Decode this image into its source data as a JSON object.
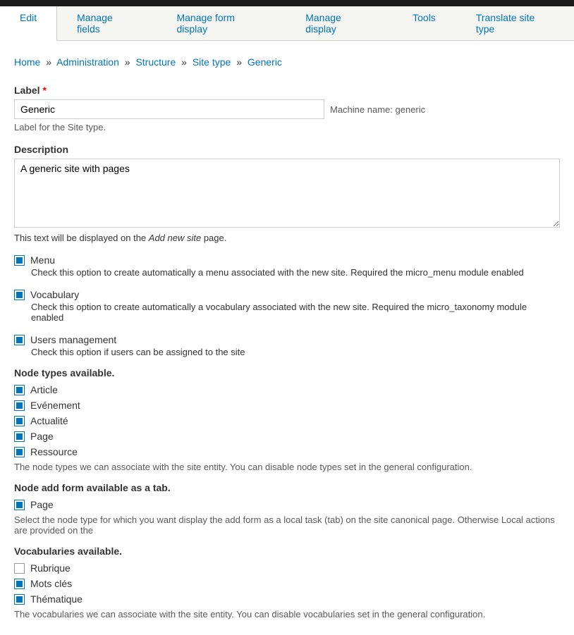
{
  "tabs": {
    "edit": "Edit",
    "manage_fields": "Manage fields",
    "manage_form_display": "Manage form display",
    "manage_display": "Manage display",
    "tools": "Tools",
    "translate": "Translate site type"
  },
  "breadcrumb": {
    "home": "Home",
    "admin": "Administration",
    "structure": "Structure",
    "site_type": "Site type",
    "current": "Generic"
  },
  "label_field": {
    "label": "Label",
    "value": "Generic",
    "help": "Label for the Site type.",
    "machine_prefix": "Machine name: ",
    "machine_value": "generic"
  },
  "description_field": {
    "label": "Description",
    "value": "A generic site with pages",
    "help_prefix": "This text will be displayed on the ",
    "help_em": "Add new site",
    "help_suffix": " page."
  },
  "options": {
    "menu": {
      "label": "Menu",
      "desc": "Check this option to create automatically a menu associated with the new site. Required the micro_menu module enabled"
    },
    "vocabulary": {
      "label": "Vocabulary",
      "desc": "Check this option to create automatically a vocabulary associated with the new site. Required the micro_taxonomy module enabled"
    },
    "users": {
      "label": "Users management",
      "desc": "Check this option if users can be assigned to the site"
    }
  },
  "node_types": {
    "label": "Node types available.",
    "items": {
      "article": "Article",
      "evenement": "Evénement",
      "actualite": "Actualité",
      "page": "Page",
      "ressource": "Ressource"
    },
    "desc": "The node types we can associate with the site entity. You can disable node types set in the general configuration."
  },
  "node_add_form": {
    "label": "Node add form available as a tab.",
    "items": {
      "page": "Page"
    },
    "desc": "Select the node type for which you want display the add form as a local task (tab) on the site canonical page. Otherwise Local actions are provided on the"
  },
  "vocabularies": {
    "label": "Vocabularies available.",
    "items": {
      "rubrique": "Rubrique",
      "mots_cles": "Mots clés",
      "thematique": "Thématique"
    },
    "desc": "The vocabularies we can associate with the site entity. You can disable vocabularies set in the general configuration."
  }
}
